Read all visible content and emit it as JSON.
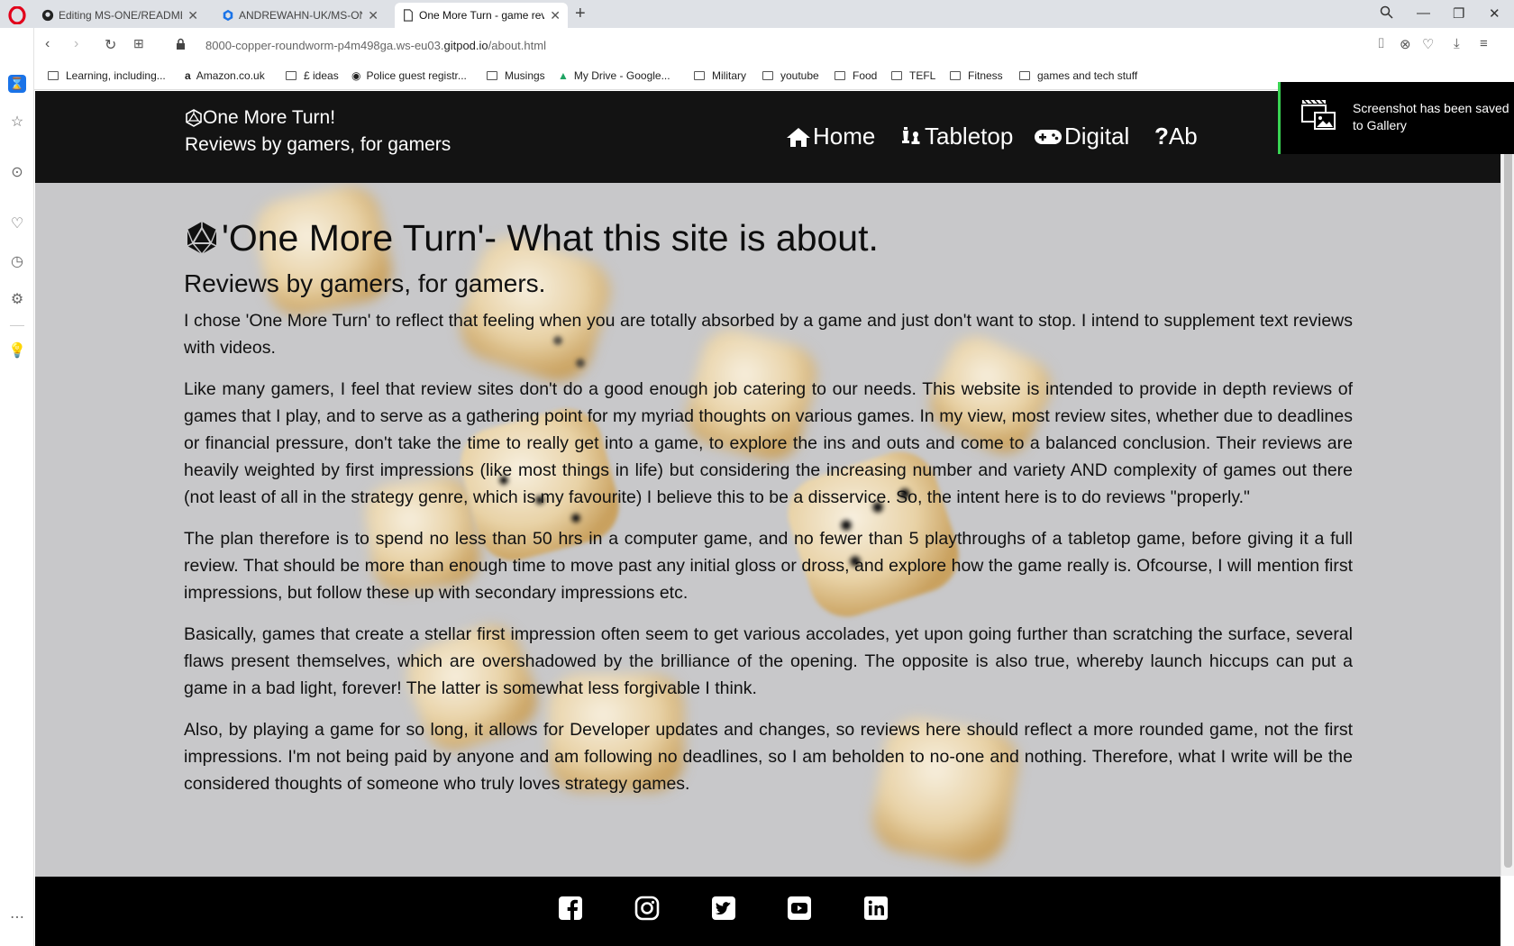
{
  "browser": {
    "tabs": [
      {
        "title": "Editing MS-ONE/README.md",
        "icon": "github-icon"
      },
      {
        "title": "ANDREWAHN-UK/MS-ONE",
        "icon": "gitpod-icon"
      },
      {
        "title": "One More Turn - game reviews",
        "icon": "page-icon"
      }
    ],
    "url_host_prefix": "8000-copper-roundworm-p4m498ga.ws-eu03.",
    "url_host_domain": "gitpod.io",
    "url_path": "/about.html",
    "bookmarks": [
      {
        "label": "Learning, including...",
        "icon": "folder-icon"
      },
      {
        "label": "Amazon.co.uk",
        "icon": "amazon-icon"
      },
      {
        "label": "£ ideas",
        "icon": "folder-icon"
      },
      {
        "label": "Police guest registr...",
        "icon": "site-icon"
      },
      {
        "label": "Musings",
        "icon": "folder-icon"
      },
      {
        "label": "My Drive - Google...",
        "icon": "drive-icon"
      },
      {
        "label": "Military",
        "icon": "folder-icon"
      },
      {
        "label": "youtube",
        "icon": "folder-icon"
      },
      {
        "label": "Food",
        "icon": "folder-icon"
      },
      {
        "label": "TEFL",
        "icon": "folder-icon"
      },
      {
        "label": "Fitness",
        "icon": "folder-icon"
      },
      {
        "label": "games and tech stuff",
        "icon": "folder-icon"
      }
    ]
  },
  "site": {
    "brand_title": "One More Turn!",
    "brand_subtitle": "Reviews by gamers, for gamers",
    "nav": [
      {
        "label": "Home",
        "icon": "home-icon"
      },
      {
        "label": "Tabletop",
        "icon": "chess-icon"
      },
      {
        "label": "Digital",
        "icon": "gamepad-icon"
      },
      {
        "label": "Ab",
        "icon": "question-icon"
      }
    ]
  },
  "main": {
    "heading": "'One More Turn'- What this site is about.",
    "subheading": "Reviews by gamers, for gamers.",
    "paragraphs": [
      "I chose 'One More Turn' to reflect that feeling when you are totally absorbed by a game and just don't want to stop. I intend to supplement text reviews with videos.",
      "Like many gamers, I feel that review sites don't do a good enough job catering to our needs. This website is intended to provide in depth reviews of games that I play, and to serve as a gathering point for my myriad thoughts on various games. In my view, most review sites, whether due to deadlines or financial pressure, don't take the time to really get into a game, to explore the ins and outs and come to a balanced conclusion. Their reviews are heavily weighted by first impressions (like most things in life) but considering the increasing number and variety AND complexity of games out there (not least of all in the strategy genre, which is my favourite) I believe this to be a disservice. So, the intent here is to do reviews \"properly.\"",
      "The plan therefore is to spend no less than 50 hrs in a computer game, and no fewer than 5 playthroughs of a tabletop game, before giving it a full review. That should be more than enough time to move past any initial gloss or dross, and explore how the game really is. Ofcourse, I will mention first impressions, but follow these up with secondary impressions etc.",
      "Basically, games that create a stellar first impression often seem to get various accolades, yet upon going further than scratching the surface, several flaws present themselves, which are overshadowed by the brilliance of the opening. The opposite is also true, whereby launch hiccups can put a game in a bad light, forever! The latter is somewhat less forgivable I think.",
      "Also, by playing a game for so long, it allows for Developer updates and changes, so reviews here should reflect a more rounded game, not the first impressions. I'm not being paid by anyone and am following no deadlines, so I am beholden to no-one and nothing. Therefore, what I write will be the considered thoughts of someone who truly loves strategy games."
    ]
  },
  "footer": {
    "social": [
      "facebook-icon",
      "instagram-icon",
      "twitter-icon",
      "youtube-icon",
      "linkedin-icon"
    ]
  },
  "toast": {
    "message": "Screenshot has been saved to Gallery"
  },
  "colors": {
    "header_bg": "#131313",
    "footer_bg": "#000000",
    "toast_accent": "#39d353",
    "opera_red": "#e2001a"
  }
}
